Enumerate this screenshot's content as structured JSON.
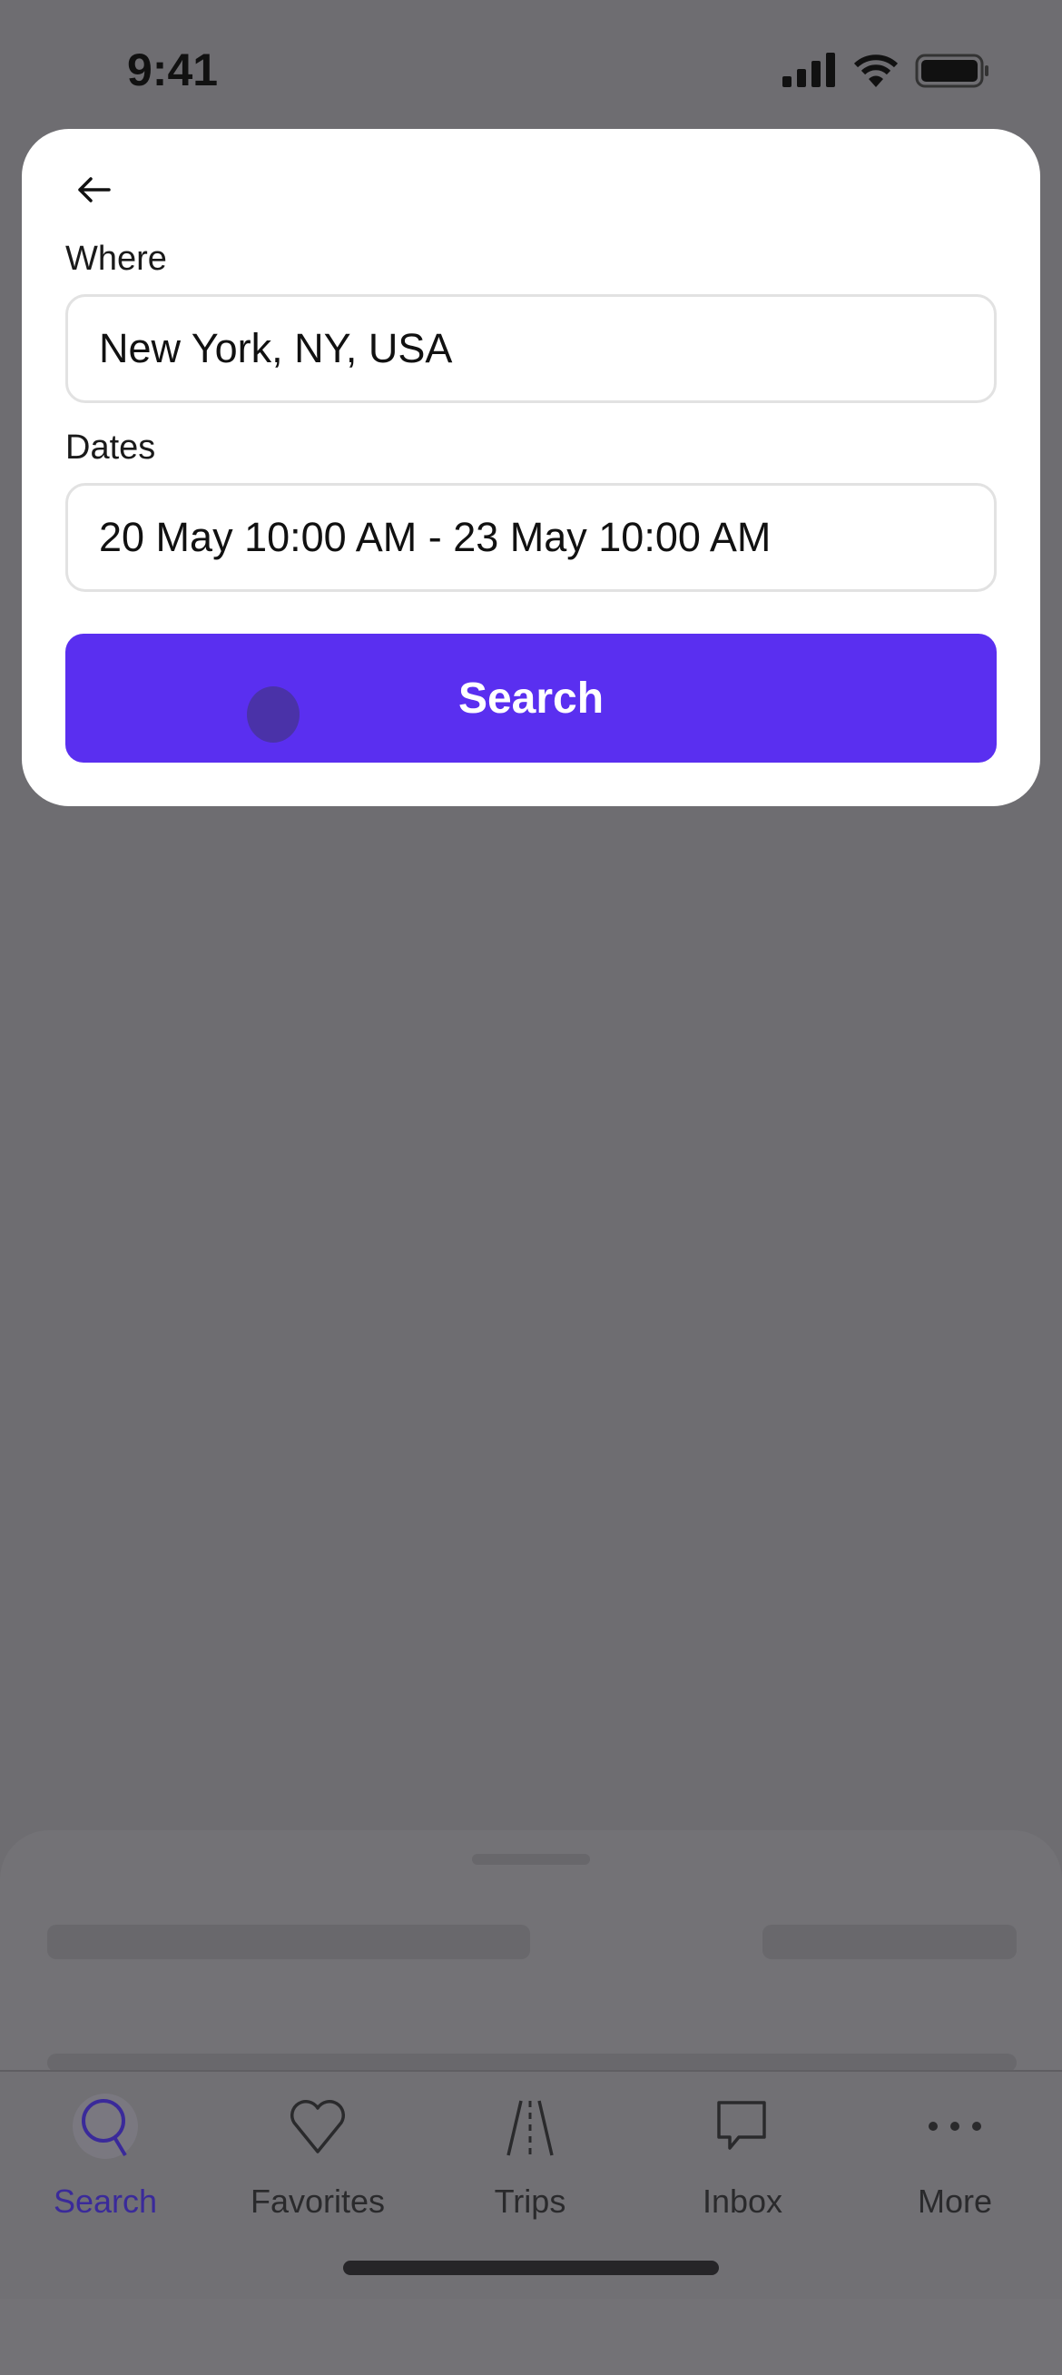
{
  "status_bar": {
    "time": "9:41"
  },
  "search_form": {
    "where_label": "Where",
    "where_value": "New York, NY, USA",
    "dates_label": "Dates",
    "dates_value": "20 May 10:00 AM - 23 May 10:00 AM",
    "search_button": "Search"
  },
  "tab_bar": {
    "items": [
      {
        "label": "Search",
        "icon": "search-icon",
        "active": true
      },
      {
        "label": "Favorites",
        "icon": "heart-icon"
      },
      {
        "label": "Trips",
        "icon": "road-icon"
      },
      {
        "label": "Inbox",
        "icon": "chat-bubble-icon"
      },
      {
        "label": "More",
        "icon": "more-dots-icon"
      }
    ]
  },
  "colors": {
    "accent": "#5a2ff0",
    "overlay": "#6e6d71"
  }
}
